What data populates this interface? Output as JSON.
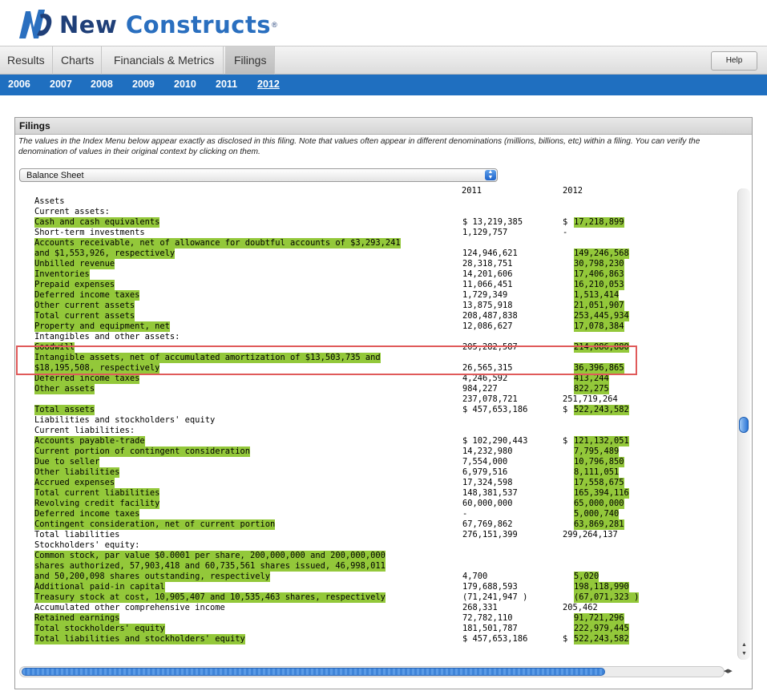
{
  "app": {
    "logo_text_1": "New ",
    "logo_text_2": "Constructs",
    "logo_reg": "®"
  },
  "tabs": [
    {
      "label": "Results"
    },
    {
      "label": "Charts"
    },
    {
      "label": "Financials & Metrics"
    },
    {
      "label": "Filings",
      "active": true
    }
  ],
  "help_label": "Help",
  "years": [
    {
      "label": "2006"
    },
    {
      "label": "2007"
    },
    {
      "label": "2008"
    },
    {
      "label": "2009"
    },
    {
      "label": "2010"
    },
    {
      "label": "2011"
    },
    {
      "label": "2012",
      "active": true
    }
  ],
  "panel": {
    "title": "Filings",
    "description": "The values in the Index Menu below appear exactly as disclosed in this filing. Note that values often appear in different denominations (millions, billions, etc) within a filing. You can verify the denomination of values in their original context by clicking on them.",
    "select_value": "Balance Sheet",
    "col_2011": "2011",
    "col_2012": "2012"
  },
  "colors": {
    "highlight": "#93c83a",
    "year_bar": "#1f6fc0",
    "red_box": "#e05a5a"
  },
  "rows": [
    {
      "label": "Assets",
      "v1": "",
      "v2": "",
      "hl_label": false,
      "hl_v2": false
    },
    {
      "label": "Current assets:",
      "v1": "",
      "v2": "",
      "hl_label": false,
      "hl_v2": false
    },
    {
      "label": "Cash and cash equivalents",
      "v1": "$ 13,219,385",
      "v2": "$",
      "v2b": "17,218,899",
      "hl_label": true,
      "hl_v2": true
    },
    {
      "label": "Short-term investments",
      "v1": "1,129,757",
      "v2": "-",
      "hl_label": false,
      "hl_v2": false
    },
    {
      "label": "Accounts receivable, net of allowance for doubtful accounts of $3,293,241",
      "v1": "",
      "v2": "",
      "hl_label": true,
      "hl_v2": false
    },
    {
      "label": "and $1,553,926, respectively",
      "v1": "124,946,621",
      "v2": "149,246,568",
      "hl_label": true,
      "hl_v2": true
    },
    {
      "label": "Unbilled revenue",
      "v1": "28,318,751",
      "v2": "30,798,230",
      "hl_label": true,
      "hl_v2": true
    },
    {
      "label": "Inventories",
      "v1": "14,201,606",
      "v2": "17,406,863",
      "hl_label": true,
      "hl_v2": true
    },
    {
      "label": "Prepaid expenses",
      "v1": "11,066,451",
      "v2": "16,210,053",
      "hl_label": true,
      "hl_v2": true
    },
    {
      "label": "Deferred income taxes",
      "v1": "1,729,349",
      "v2": "1,513,414",
      "hl_label": true,
      "hl_v2": true
    },
    {
      "label": "Other current assets",
      "v1": "13,875,918",
      "v2": "21,051,907",
      "hl_label": true,
      "hl_v2": true
    },
    {
      "label": "Total current assets",
      "v1": "208,487,838",
      "v2": "253,445,934",
      "hl_label": true,
      "hl_v2": true
    },
    {
      "label": "Property and equipment, net",
      "v1": "12,086,627",
      "v2": "17,078,384",
      "hl_label": true,
      "hl_v2": true
    },
    {
      "label": "Intangibles and other assets:",
      "v1": "",
      "v2": "",
      "hl_label": false,
      "hl_v2": false
    },
    {
      "label": "Goodwill",
      "v1": "205,282,587",
      "v2": "214,086,880",
      "hl_label": true,
      "hl_v2": true
    },
    {
      "label": "Intangible assets, net of accumulated amortization of $13,503,735 and",
      "v1": "",
      "v2": "",
      "hl_label": true,
      "hl_v2": false
    },
    {
      "label": "$18,195,508, respectively",
      "v1": "26,565,315",
      "v2": "36,396,865",
      "hl_label": true,
      "hl_v2": true
    },
    {
      "label": "Deferred income taxes",
      "v1": "4,246,592",
      "v2": "413,244",
      "hl_label": true,
      "hl_v2": true
    },
    {
      "label": "Other assets",
      "v1": "984,227",
      "v2": "822,275",
      "hl_label": true,
      "hl_v2": true
    },
    {
      "label": "",
      "v1": "237,078,721",
      "v2": "251,719,264",
      "hl_label": false,
      "hl_v2": false
    },
    {
      "label": "Total assets",
      "v1": "$ 457,653,186",
      "v2": "$",
      "v2b": "522,243,582",
      "hl_label": true,
      "hl_v2": true
    },
    {
      "label": "Liabilities and stockholders' equity",
      "v1": "",
      "v2": "",
      "hl_label": false,
      "hl_v2": false
    },
    {
      "label": "Current liabilities:",
      "v1": "",
      "v2": "",
      "hl_label": false,
      "hl_v2": false
    },
    {
      "label": "Accounts payable-trade",
      "v1": "$ 102,290,443",
      "v2": "$",
      "v2b": "121,132,051",
      "hl_label": true,
      "hl_v2": true
    },
    {
      "label": "Current portion of contingent consideration",
      "v1": "14,232,980",
      "v2": "7,795,489",
      "hl_label": true,
      "hl_v2": true
    },
    {
      "label": "Due to seller",
      "v1": "7,554,000",
      "v2": "10,796,850",
      "hl_label": true,
      "hl_v2": true
    },
    {
      "label": "Other liabilities",
      "v1": "6,979,516",
      "v2": "8,111,051",
      "hl_label": true,
      "hl_v2": true
    },
    {
      "label": "Accrued expenses",
      "v1": "17,324,598",
      "v2": "17,558,675",
      "hl_label": true,
      "hl_v2": true
    },
    {
      "label": "Total current liabilities",
      "v1": "148,381,537",
      "v2": "165,394,116",
      "hl_label": true,
      "hl_v2": true
    },
    {
      "label": "Revolving credit facility",
      "v1": "60,000,000",
      "v2": "65,000,000",
      "hl_label": true,
      "hl_v2": true
    },
    {
      "label": "Deferred income taxes",
      "v1": "-",
      "v2": "5,000,740",
      "hl_label": true,
      "hl_v2": true
    },
    {
      "label": "Contingent consideration, net of current portion",
      "v1": "67,769,862",
      "v2": "63,869,281",
      "hl_label": true,
      "hl_v2": true
    },
    {
      "label": "Total liabilities",
      "v1": "276,151,399",
      "v2": "299,264,137",
      "hl_label": false,
      "hl_v2": false
    },
    {
      "label": "Stockholders' equity:",
      "v1": "",
      "v2": "",
      "hl_label": false,
      "hl_v2": false
    },
    {
      "label": "Common stock, par value $0.0001 per share, 200,000,000 and 200,000,000",
      "v1": "",
      "v2": "",
      "hl_label": true,
      "hl_v2": false
    },
    {
      "label": "shares authorized, 57,903,418 and 60,735,561 shares issued, 46,998,011",
      "v1": "",
      "v2": "",
      "hl_label": true,
      "hl_v2": false
    },
    {
      "label": "and 50,200,098 shares outstanding, respectively",
      "v1": "4,700",
      "v2": "5,020",
      "hl_label": true,
      "hl_v2": true
    },
    {
      "label": "Additional paid-in capital",
      "v1": "179,688,593",
      "v2": "198,118,990",
      "hl_label": true,
      "hl_v2": true
    },
    {
      "label": "Treasury stock at cost, 10,905,407 and 10,535,463 shares, respectively",
      "v1": "(71,241,947 )",
      "v2": "(67,071,323 )",
      "hl_label": true,
      "hl_v2": true
    },
    {
      "label": "Accumulated other comprehensive income",
      "v1": "268,331",
      "v2": "205,462",
      "hl_label": false,
      "hl_v2": false
    },
    {
      "label": "Retained earnings",
      "v1": "72,782,110",
      "v2": "91,721,296",
      "hl_label": true,
      "hl_v2": true
    },
    {
      "label": "Total stockholders' equity",
      "v1": "181,501,787",
      "v2": "222,979,445",
      "hl_label": true,
      "hl_v2": true
    },
    {
      "label": "Total liabilities and stockholders' equity",
      "v1": "$ 457,653,186",
      "v2": "$",
      "v2b": "522,243,582",
      "hl_label": true,
      "hl_v2": true
    }
  ]
}
